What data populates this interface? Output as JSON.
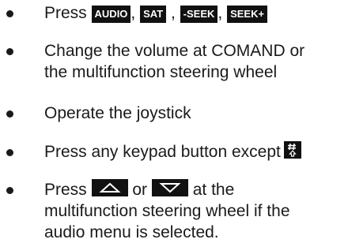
{
  "items": [
    {
      "prefix": "Press",
      "keys": [
        "AUDIO",
        "SAT",
        "-SEEK",
        "SEEK+"
      ],
      "separators": [
        ", ",
        " , ",
        ", "
      ]
    },
    {
      "lines": [
        "Change the volume at COMAND or",
        "the multifunction steering wheel"
      ]
    },
    {
      "lines": [
        "Operate the joystick"
      ]
    },
    {
      "text": "Press any keypad button except",
      "key_icon": "hash-key-icon"
    },
    {
      "word_press": "Press",
      "up_icon": "up-arrow-key-icon",
      "word_or": "or",
      "down_icon": "down-arrow-key-icon",
      "suffix": "at the",
      "lines_after": [
        "multifunction steering wheel if the",
        "audio menu is selected."
      ]
    }
  ]
}
